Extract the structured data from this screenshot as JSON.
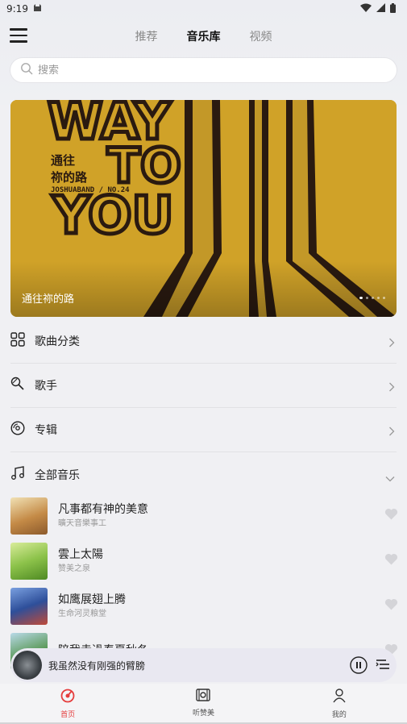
{
  "status_bar": {
    "time": "9:19"
  },
  "header": {
    "tabs": [
      {
        "label": "推荐"
      },
      {
        "label": "音乐库"
      },
      {
        "label": "视频"
      }
    ]
  },
  "search": {
    "placeholder": "搜索"
  },
  "banner": {
    "caption": "通往祢的路",
    "art_text": {
      "way": "WAY",
      "to": "TO",
      "you": "YOU",
      "cn_line1": "通往",
      "cn_line2": "祢的路",
      "band": "JOSHUABAND / NO.24"
    },
    "page_count": 5,
    "active_page": 1
  },
  "menu": [
    {
      "label": "歌曲分类",
      "icon": "grid-icon"
    },
    {
      "label": "歌手",
      "icon": "microphone-icon"
    },
    {
      "label": "专辑",
      "icon": "disc-icon"
    },
    {
      "label": "全部音乐",
      "icon": "music-note-icon"
    }
  ],
  "songs": [
    {
      "title": "凡事都有神的美意",
      "artist": "曠天音樂事工"
    },
    {
      "title": "雲上太陽",
      "artist": "赞美之泉"
    },
    {
      "title": "如鹰展翅上腾",
      "artist": "生命河灵粮堂"
    },
    {
      "title": "陪我走過春夏秋冬",
      "artist": ""
    }
  ],
  "player": {
    "title": "我虽然没有刚强的臂膀"
  },
  "bottom_nav": [
    {
      "label": "首页"
    },
    {
      "label": "听赞美"
    },
    {
      "label": "我的"
    }
  ],
  "colors": {
    "accent": "#e53d3d",
    "banner_bg": "#d3a52a"
  }
}
